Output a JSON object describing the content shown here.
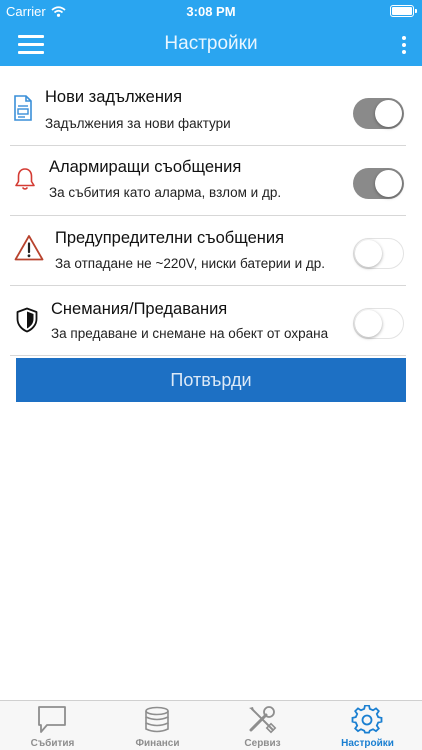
{
  "status_bar": {
    "carrier": "Carrier",
    "time": "3:08 PM"
  },
  "nav": {
    "title": "Настройки"
  },
  "settings": [
    {
      "title": "Нови задължения",
      "subtitle": "Задължения за нови фактури",
      "icon": "document-icon",
      "enabled": true
    },
    {
      "title": "Алармиращи съобщения",
      "subtitle": "За събития като аларма, взлом и др.",
      "icon": "bell-icon",
      "enabled": true
    },
    {
      "title": "Предупредителни съобщения",
      "subtitle": "За отпадане не ~220V, ниски батерии и др.",
      "icon": "warning-icon",
      "enabled": false
    },
    {
      "title": "Снемания/Предавания",
      "subtitle": "За предаване и снемане на обект от охрана",
      "icon": "shield-icon",
      "enabled": false
    }
  ],
  "confirm_button": "Потвърди",
  "tabs": [
    {
      "label": "Събития",
      "icon": "chat-bubble-icon",
      "active": false
    },
    {
      "label": "Финанси",
      "icon": "coins-icon",
      "active": false
    },
    {
      "label": "Сервиз",
      "icon": "tools-icon",
      "active": false
    },
    {
      "label": "Настройки",
      "icon": "gear-icon",
      "active": true
    }
  ],
  "colors": {
    "header": "#2aa5f0",
    "button": "#1d70c4",
    "active_tab": "#1a7fd1",
    "bell_icon": "#d43b33",
    "warning_icon": "#b8432e",
    "document_icon": "#3a8fd8"
  }
}
